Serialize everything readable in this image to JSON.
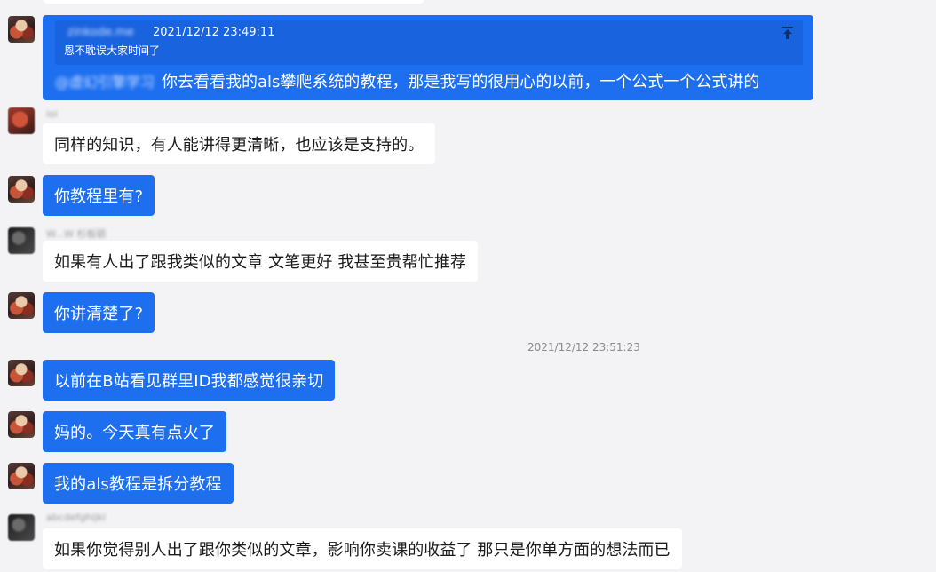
{
  "messages": {
    "m1": {
      "quote": {
        "sender": "zinkode.me",
        "time": "2021/12/12 23:49:11",
        "text": "恩不耽误大家时间了"
      },
      "mention": "@虚幻引擎学习",
      "text": "你去看看我的als攀爬系统的教程，那是我写的很用心的以前，一个公式一个公式讲的"
    },
    "m2": {
      "sender": "ioi",
      "text": "同样的知识，有人能讲得更清晰，也应该是支持的。"
    },
    "m3": {
      "text": "你教程里有?"
    },
    "m4": {
      "sender": "W...W 杉板砺",
      "text": "如果有人出了跟我类似的文章  文笔更好 我甚至贵帮忙推荐"
    },
    "m5": {
      "text": "你讲清楚了?"
    },
    "timestamp": "2021/12/12 23:51:23",
    "m6": {
      "text": "以前在B站看见群里ID我都感觉很亲切"
    },
    "m7": {
      "text": "妈的。今天真有点火了"
    },
    "m8": {
      "text": "我的als教程是拆分教程"
    },
    "m9": {
      "sender": "abcdefghijkl",
      "text": "如果你觉得别人出了跟你类似的文章，影响你卖课的收益了  那只是你单方面的想法而已"
    }
  },
  "colors": {
    "blue_bubble": "#1d6ff0",
    "white_bubble": "#ffffff",
    "background": "#f3f3f6"
  },
  "icons": {
    "jump_to_quote": "arrow-up-to-line-icon"
  }
}
